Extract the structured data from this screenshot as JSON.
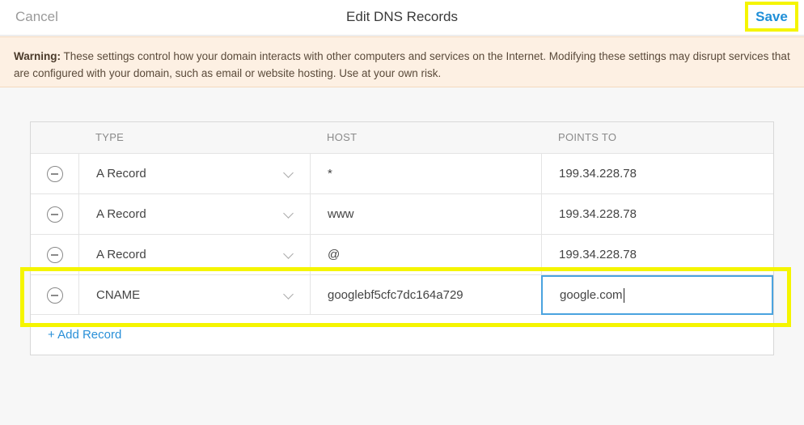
{
  "header": {
    "cancel_label": "Cancel",
    "title": "Edit DNS Records",
    "save_label": "Save"
  },
  "warning": {
    "label": "Warning:",
    "text": " These settings control how your domain interacts with other computers and services on the Internet. Modifying these settings may disrupt services that are configured with your domain, such as email or website hosting. Use at your own risk."
  },
  "table": {
    "columns": [
      "TYPE",
      "HOST",
      "POINTS TO"
    ],
    "rows": [
      {
        "type": "A Record",
        "host": "*",
        "points_to": "199.34.228.78"
      },
      {
        "type": "A Record",
        "host": "www",
        "points_to": "199.34.228.78"
      },
      {
        "type": "A Record",
        "host": "@",
        "points_to": "199.34.228.78"
      },
      {
        "type": "CNAME",
        "host": "googlebf5cfc7dc164a729",
        "points_to": "google.com"
      }
    ],
    "add_record_label": "+ Add Record"
  },
  "colors": {
    "accent": "#1f8fd8",
    "highlight": "#f5f500",
    "warning_bg": "#fdf0e3"
  },
  "icons": {
    "remove": "minus-circle-icon",
    "dropdown": "chevron-down-icon"
  }
}
